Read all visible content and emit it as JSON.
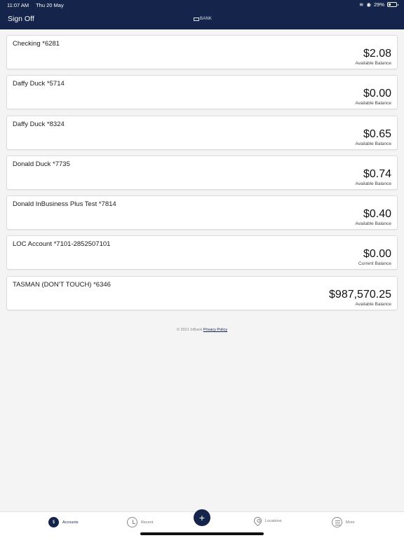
{
  "status_bar": {
    "time": "11:07 AM",
    "date": "Thu 20 May",
    "battery": "29%"
  },
  "header": {
    "sign_off": "Sign Off",
    "logo_text": "BANK"
  },
  "accounts": [
    {
      "name": "Checking *6281",
      "amount": "$2.08",
      "label": "Available Balance"
    },
    {
      "name": "Daffy Duck *5714",
      "amount": "$0.00",
      "label": "Available Balance"
    },
    {
      "name": "Daffy Duck *8324",
      "amount": "$0.65",
      "label": "Available Balance"
    },
    {
      "name": "Donald Duck *7735",
      "amount": "$0.74",
      "label": "Available Balance"
    },
    {
      "name": "Donald InBusiness Plus Test *7814",
      "amount": "$0.40",
      "label": "Available Balance"
    },
    {
      "name": "LOC Account *7101-2852507101",
      "amount": "$0.00",
      "label": "Current Balance"
    },
    {
      "name": "TASMAN (DON'T TOUCH) *6346",
      "amount": "$987,570.25",
      "label": "Available Balance"
    }
  ],
  "footer": {
    "copyright": "© 2021 InBank",
    "privacy": "Privacy Policy"
  },
  "tabbar": {
    "accounts": "Accounts",
    "recent": "Recent",
    "add": "+",
    "locations": "Locations",
    "more": "More",
    "active_tab": "accounts"
  },
  "colors": {
    "brand": "#14244a",
    "background": "#f4f4f5"
  }
}
